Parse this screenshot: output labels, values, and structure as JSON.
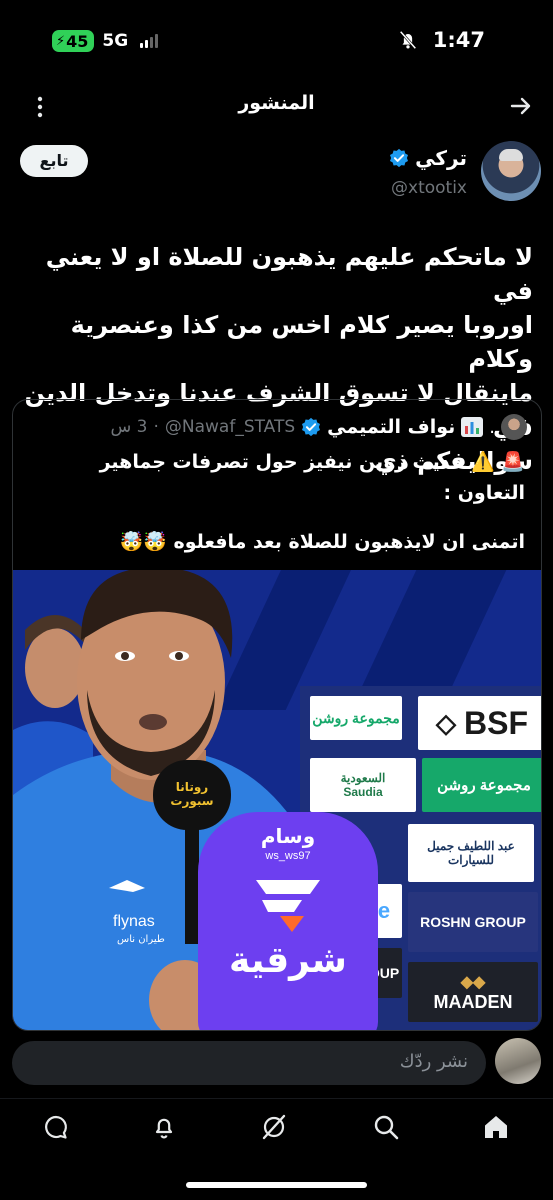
{
  "status_bar": {
    "time": "1:47",
    "battery": "45",
    "network": "5G"
  },
  "header": {
    "title": "المنشور"
  },
  "post": {
    "author_name": "تركي",
    "author_handle": "@xtootix",
    "follow_label": "تابع",
    "text_lines": [
      "لا ماتحكم عليهم يذهبون للصلاة او لا يعني في",
      "اوروبا يصير كلام اخس من كذا وعنصرية وكلام",
      "ماينقال لا تسوق الشرف عندنا وتدخل الدين في",
      "سواليفكم ذي"
    ]
  },
  "quote": {
    "author_name": "نواف التميمي",
    "author_handle": "@Nawaf_STATS",
    "time": "3 س",
    "line1": "🚨 ⚠️ حديث روبن نيفيز حول تصرفات جماهير",
    "line2": "التعاون :",
    "line3": "اتمنى ان لايذهبون للصلاة بعد مافعلوه 🤯🤯"
  },
  "media": {
    "mic_name": "وسام",
    "mic_handle": "ws_ws97",
    "mic_brand": "شرقية",
    "sponsors": [
      "BSF",
      "مجموعة روشن",
      "مجموعة روشن",
      "السعودية",
      "Saudia",
      "مجموعة روشن",
      "عبد اللطيف جميل",
      "للسيارات",
      "ROSHN GROUP",
      "MAADEN",
      "OUP",
      "e"
    ],
    "shirt_sponsor": "flynas",
    "shirt_sponsor_ar": "طيران ناس",
    "second_mic": "روتانا سبورت"
  },
  "reply": {
    "placeholder": "نشر ردّك"
  },
  "nav": {
    "items": [
      "home-icon",
      "search-icon",
      "grok-icon",
      "notifications-icon",
      "messages-icon"
    ]
  }
}
